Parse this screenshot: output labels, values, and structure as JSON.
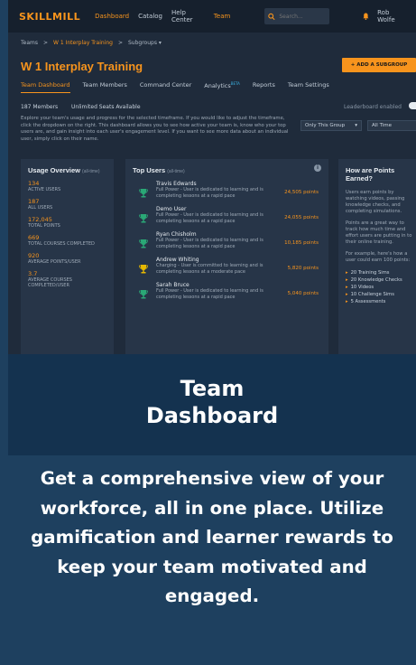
{
  "nav": {
    "logo": "SKILLMILL",
    "items": [
      "Dashboard",
      "Catalog",
      "Help Center",
      "Team"
    ],
    "search_placeholder": "Search...",
    "user": "Rob Wolfe"
  },
  "breadcrumb": [
    "Teams",
    ">",
    "W 1 Interplay Training",
    ">",
    "Subgroups ▾"
  ],
  "page_title": "W 1 Interplay Training",
  "add_button": "+ ADD A SUBGROUP",
  "tabs": [
    "Team Dashboard",
    "Team Members",
    "Command Center",
    "Analytics",
    "Reports",
    "Team Settings"
  ],
  "tab_beta": "BETA",
  "meta": {
    "members": "187 Members",
    "seats": "Unlimited Seats Available",
    "leaderboard": "Leaderboard enabled"
  },
  "description": "Explore your team's usage and progress for the selected timeframe. If you would like to adjust the timeframe, click the dropdown on the right. This dashboard allows you to see how active your team is, know who your top users are, and gain insight into each user's engagement level. If you want to see more data about an individual user, simply click on their name.",
  "filters": [
    "Only This Group",
    "All Time"
  ],
  "usage": {
    "title": "Usage Overview",
    "sub": "(all-time)",
    "stats": [
      {
        "value": "134",
        "label": "ACTIVE USERS"
      },
      {
        "value": "187",
        "label": "ALL USERS"
      },
      {
        "value": "172,045",
        "label": "TOTAL POINTS"
      },
      {
        "value": "669",
        "label": "TOTAL COURSES COMPLETED"
      },
      {
        "value": "920",
        "label": "AVERAGE POINTS/USER"
      },
      {
        "value": "3.7",
        "label": "AVERAGE COURSES COMPLETED/USER"
      }
    ]
  },
  "top_users": {
    "title": "Top Users",
    "sub": "(all-time)",
    "users": [
      {
        "name": "Travis Edwards",
        "desc": "Full Power - User is dedicated to learning and is completing lessons at a rapid pace",
        "points": "24,505 points",
        "trophy": "#2aa876"
      },
      {
        "name": "Demo User",
        "desc": "Full Power - User is dedicated to learning and is completing lessons at a rapid pace",
        "points": "24,055 points",
        "trophy": "#2aa876"
      },
      {
        "name": "Ryan Chisholm",
        "desc": "Full Power - User is dedicated to learning and is completing lessons at a rapid pace",
        "points": "10,185 points",
        "trophy": "#2aa876"
      },
      {
        "name": "Andrew Whiting",
        "desc": "Charging - User is committed to learning and is completing lessons at a moderate pace",
        "points": "5,820 points",
        "trophy": "#e6b800"
      },
      {
        "name": "Sarah Bruce",
        "desc": "Full Power - User is dedicated to learning and is completing lessons at a rapid pace",
        "points": "5,040 points",
        "trophy": "#2aa876"
      }
    ]
  },
  "points_info": {
    "title": "How are Points Earned?",
    "p1": "Users earn points by watching videos, passing knowledge checks, and completing simulations.",
    "p2": "Points are a great way to track how much time and effort users are putting in to their online training.",
    "p3": "For example, here's how a user could earn 100 points:",
    "list": [
      "20 Training Sims",
      "20 Knowledge Checks",
      "10 Videos",
      "10 Challenge Sims",
      "5 Assessments"
    ]
  },
  "caption": {
    "title": "Team\nDashboard",
    "body": "Get a comprehensive view of your workforce, all in one place. Utilize gamification and learner rewards to keep your team motivated and engaged."
  },
  "colors": {
    "accent": "#f7941d",
    "background": "#1e405f",
    "caption_bg": "#14324f"
  }
}
